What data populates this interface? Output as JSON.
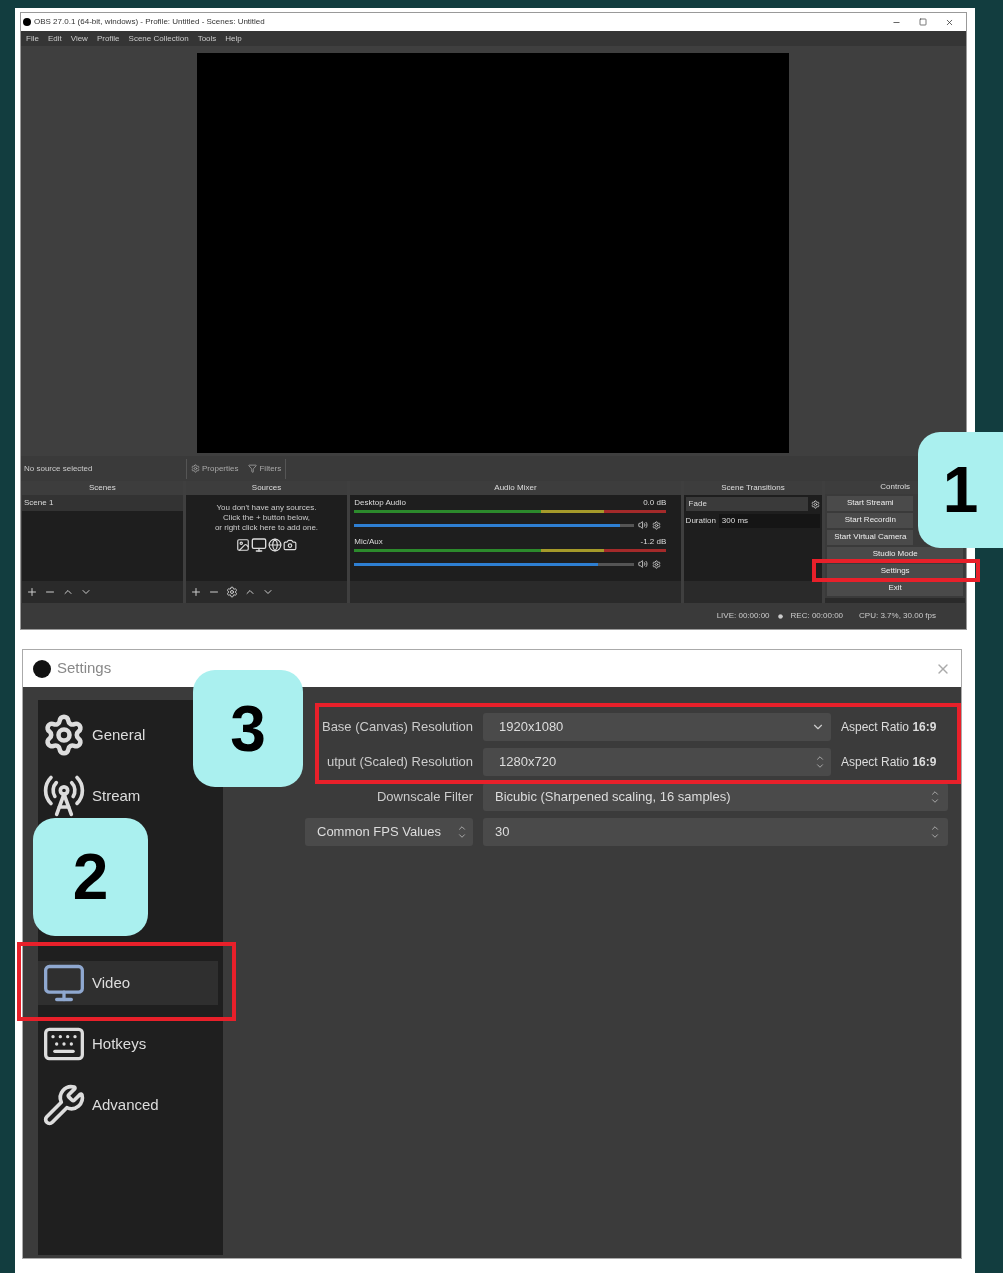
{
  "main_window": {
    "title": "OBS 27.0.1 (64-bit, windows) - Profile: Untitled - Scenes: Untitled",
    "menu": [
      "File",
      "Edit",
      "View",
      "Profile",
      "Scene Collection",
      "Tools",
      "Help"
    ],
    "source_bar": {
      "status": "No source selected",
      "buttons": [
        "Properties",
        "Filters"
      ]
    },
    "scenes": {
      "title": "Scenes",
      "items": [
        {
          "label": "Scene 1",
          "selected": true
        }
      ]
    },
    "sources": {
      "title": "Sources",
      "empty_message": "You don't have any sources.\nClick the + button below,\nor right click here to add one."
    },
    "audio_mixer": {
      "title": "Audio Mixer",
      "channels": [
        {
          "name": "Desktop Audio",
          "reading": "0.0 dB",
          "level": 0.95
        },
        {
          "name": "Mic/Aux",
          "reading": "-1.2 dB",
          "level": 0.87
        }
      ]
    },
    "scene_transitions": {
      "title": "Scene Transitions",
      "transition": "Fade",
      "duration_label": "Duration",
      "duration": "300 ms"
    },
    "controls": {
      "title": "Controls",
      "buttons": [
        "Start Streami",
        "Start Recordin",
        "Start Virtual Camera",
        "Studio Mode",
        "Settings",
        "Exit"
      ]
    },
    "status_bar": {
      "live": "LIVE: 00:00:00",
      "rec": "REC: 00:00:00",
      "cpu": "CPU: 3.7%, 30.00 fps"
    }
  },
  "settings_window": {
    "title": "Settings",
    "categories": [
      {
        "label": "General",
        "selected": false
      },
      {
        "label": "Stream",
        "selected": false
      },
      {
        "label": "Video",
        "selected": true
      },
      {
        "label": "Hotkeys",
        "selected": false
      },
      {
        "label": "Advanced",
        "selected": false
      }
    ],
    "rows": [
      {
        "kind": "dropdown",
        "label": "Base (Canvas) Resolution",
        "value": "1920x1080",
        "note": "Aspect Ratio **16:9**"
      },
      {
        "kind": "spinner",
        "label": "utput (Scaled) Resolution",
        "value": "1280x720",
        "note": "Aspect Ratio **16:9**"
      },
      {
        "kind": "spinner",
        "label": "Downscale Filter",
        "value": "Bicubic (Sharpened scaling, 16 samples)"
      },
      {
        "kind": "fps",
        "label": "Common FPS Values",
        "value": "30"
      }
    ]
  },
  "callouts": [
    "1",
    "2",
    "3"
  ]
}
